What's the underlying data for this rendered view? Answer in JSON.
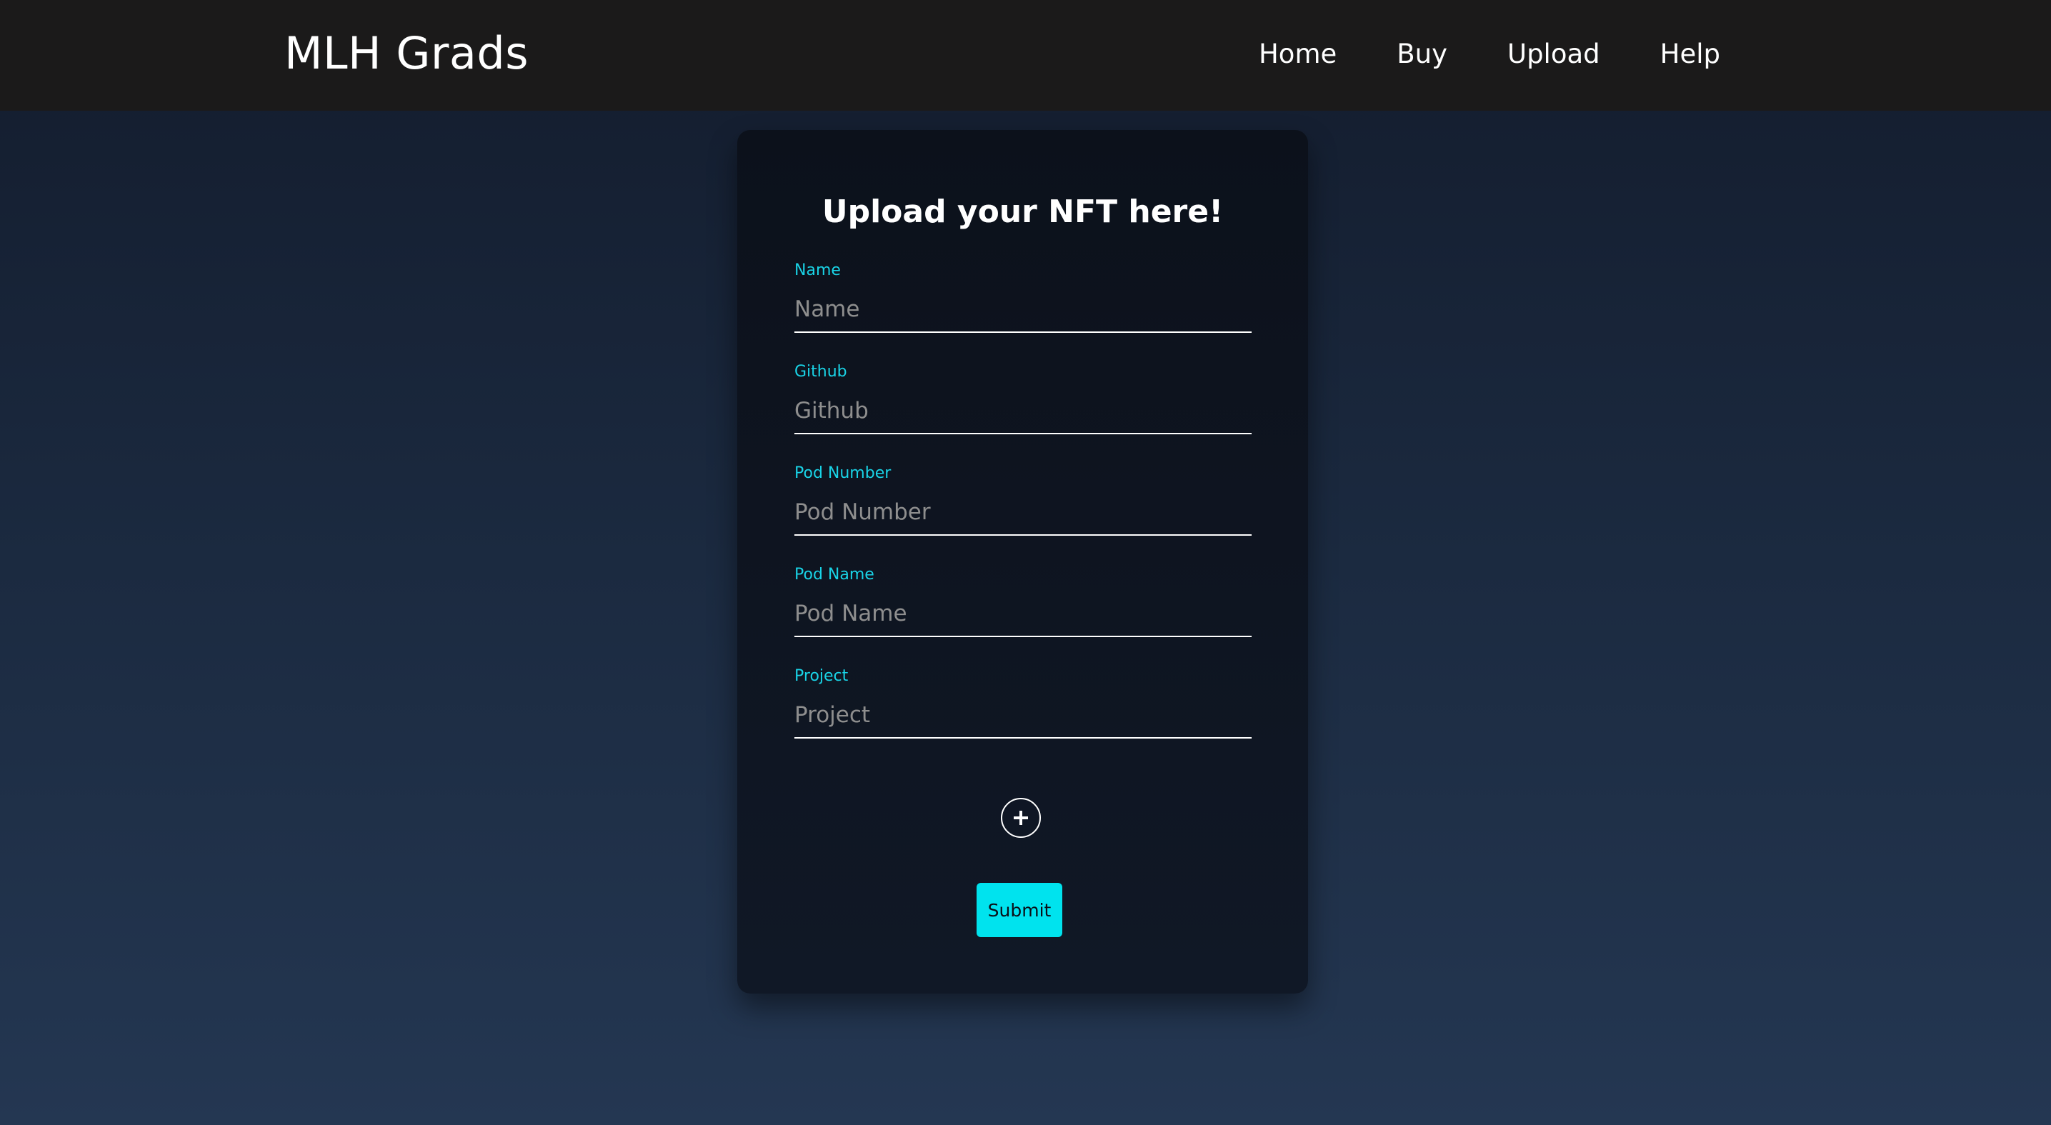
{
  "nav": {
    "brand": "MLH Grads",
    "links": [
      "Home",
      "Buy",
      "Upload",
      "Help"
    ]
  },
  "form": {
    "title": "Upload your NFT here!",
    "fields": [
      {
        "label": "Name",
        "placeholder": "Name"
      },
      {
        "label": "Github",
        "placeholder": "Github"
      },
      {
        "label": "Pod Number",
        "placeholder": "Pod Number"
      },
      {
        "label": "Pod Name",
        "placeholder": "Pod Name"
      },
      {
        "label": "Project",
        "placeholder": "Project"
      }
    ],
    "add_icon": "plus-circle-icon",
    "submit_label": "Submit"
  },
  "colors": {
    "navbar": "#1b1a1a",
    "accent": "#00e3ee",
    "label": "#19d3e6",
    "card": "#0c111b"
  }
}
